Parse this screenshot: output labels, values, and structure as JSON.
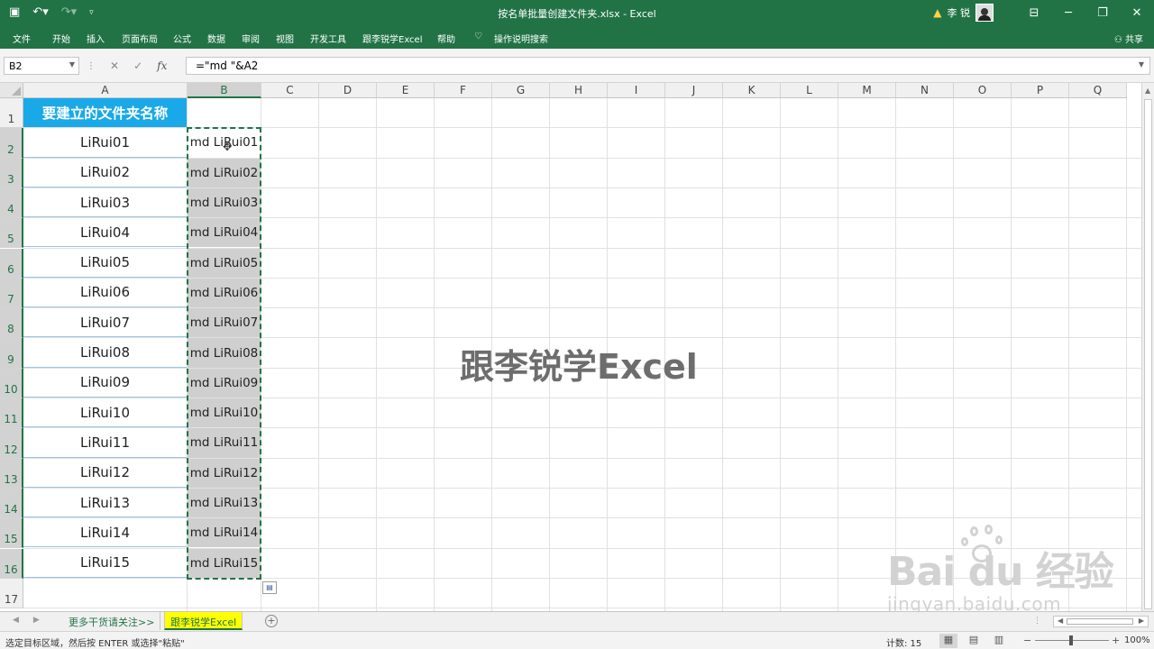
{
  "window": {
    "title": "按名单批量创建文件夹.xlsx - Excel",
    "user": "李 锐"
  },
  "ribbon": {
    "tabs": [
      "文件",
      "开始",
      "插入",
      "页面布局",
      "公式",
      "数据",
      "审阅",
      "视图",
      "开发工具",
      "跟李锐学Excel",
      "帮助",
      "操作说明搜索"
    ],
    "share": "共享"
  },
  "formula_bar": {
    "name_box": "B2",
    "formula": "=\"md \"&A2"
  },
  "columns": [
    "A",
    "B",
    "C",
    "D",
    "E",
    "F",
    "G",
    "H",
    "I",
    "J",
    "K",
    "L",
    "M",
    "N",
    "O",
    "P",
    "Q"
  ],
  "selected_column": "B",
  "rows": [
    "1",
    "2",
    "3",
    "4",
    "5",
    "6",
    "7",
    "8",
    "9",
    "10",
    "11",
    "12",
    "13",
    "14",
    "15",
    "16",
    "17"
  ],
  "sheet": {
    "header": "要建立的文件夹名称",
    "names": [
      "LiRui01",
      "LiRui02",
      "LiRui03",
      "LiRui04",
      "LiRui05",
      "LiRui06",
      "LiRui07",
      "LiRui08",
      "LiRui09",
      "LiRui10",
      "LiRui11",
      "LiRui12",
      "LiRui13",
      "LiRui14",
      "LiRui15"
    ],
    "commands": [
      "md LiRui01",
      "md LiRui02",
      "md LiRui03",
      "md LiRui04",
      "md LiRui05",
      "md LiRui06",
      "md LiRui07",
      "md LiRui08",
      "md LiRui09",
      "md LiRui10",
      "md LiRui11",
      "md LiRui12",
      "md LiRui13",
      "md LiRui14",
      "md LiRui15"
    ]
  },
  "overlay_text": "跟李锐学Excel",
  "watermark": {
    "logo": "Bai du 经验",
    "url": "jingyan.baidu.com"
  },
  "sheet_tabs": [
    "更多干货请关注>>",
    "跟李锐学Excel"
  ],
  "status_bar": {
    "message": "选定目标区域，然后按 ENTER 或选择\"粘贴\"",
    "count": "计数: 15",
    "zoom": "100%"
  },
  "colors": {
    "excel_green": "#217346",
    "header_fill": "#1aa9e8",
    "active_tab_fill": "#ffff00"
  }
}
